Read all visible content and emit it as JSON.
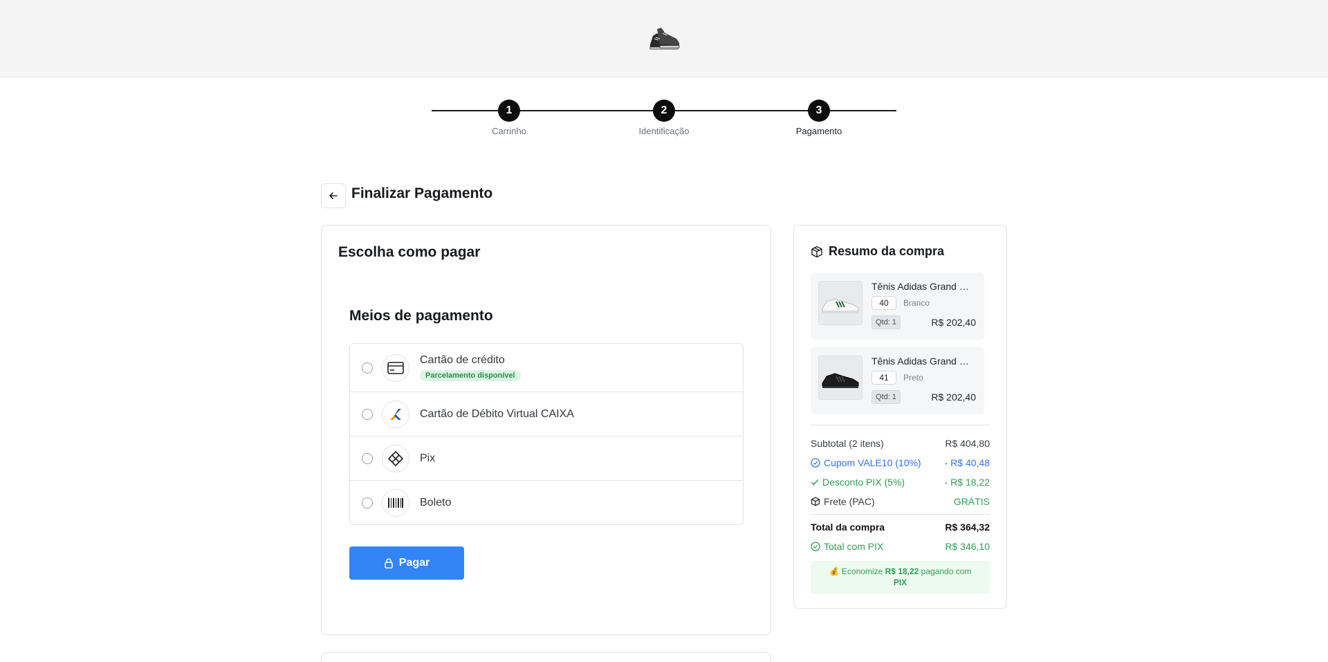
{
  "header": {
    "logo_alt": "sneaker-logo"
  },
  "stepper": {
    "steps": [
      {
        "number": "1",
        "label": "Carrinho"
      },
      {
        "number": "2",
        "label": "Identificação"
      },
      {
        "number": "3",
        "label": "Pagamento"
      }
    ]
  },
  "page": {
    "title": "Finalizar Pagamento"
  },
  "payment": {
    "card_title": "Escolha como pagar",
    "methods_title": "Meios de pagamento",
    "methods": [
      {
        "label": "Cartão de crédito",
        "badge": "Parcelamento disponível",
        "icon": "credit-card-icon"
      },
      {
        "label": "Cartão de Débito Virtual CAIXA",
        "icon": "caixa-logo-icon"
      },
      {
        "label": "Pix",
        "icon": "pix-icon"
      },
      {
        "label": "Boleto",
        "icon": "barcode-icon"
      }
    ],
    "pay_button": "Pagar"
  },
  "summary": {
    "title": "Resumo da compra",
    "items": [
      {
        "name": "Tênis Adidas Grand Court",
        "size": "40",
        "color": "Branco",
        "qty": "Qtd: 1",
        "price": "R$ 202,40"
      },
      {
        "name": "Tênis Adidas Grand Court",
        "size": "41",
        "color": "Preto",
        "qty": "Qtd: 1",
        "price": "R$ 202,40"
      }
    ],
    "subtotal_label": "Subtotal (2 itens)",
    "subtotal_value": "R$ 404,80",
    "coupon_label": "Cupom VALE10 (10%)",
    "coupon_value": "- R$ 40,48",
    "pix_discount_label": "Desconto PIX (5%)",
    "pix_discount_value": "- R$ 18,22",
    "shipping_label": "Frete (PAC)",
    "shipping_value": "GRÁTIS",
    "total_label": "Total da compra",
    "total_value": "R$ 364,32",
    "total_pix_label": "Total com PIX",
    "total_pix_value": "R$ 346,10",
    "savings_prefix": "💰 Economize ",
    "savings_amount": "R$ 18,22",
    "savings_middle": " pagando com ",
    "savings_method": "PIX"
  },
  "colors": {
    "primary_button": "#3385f5",
    "coupon_blue": "#3471e8",
    "success_green": "#2f9e53"
  }
}
